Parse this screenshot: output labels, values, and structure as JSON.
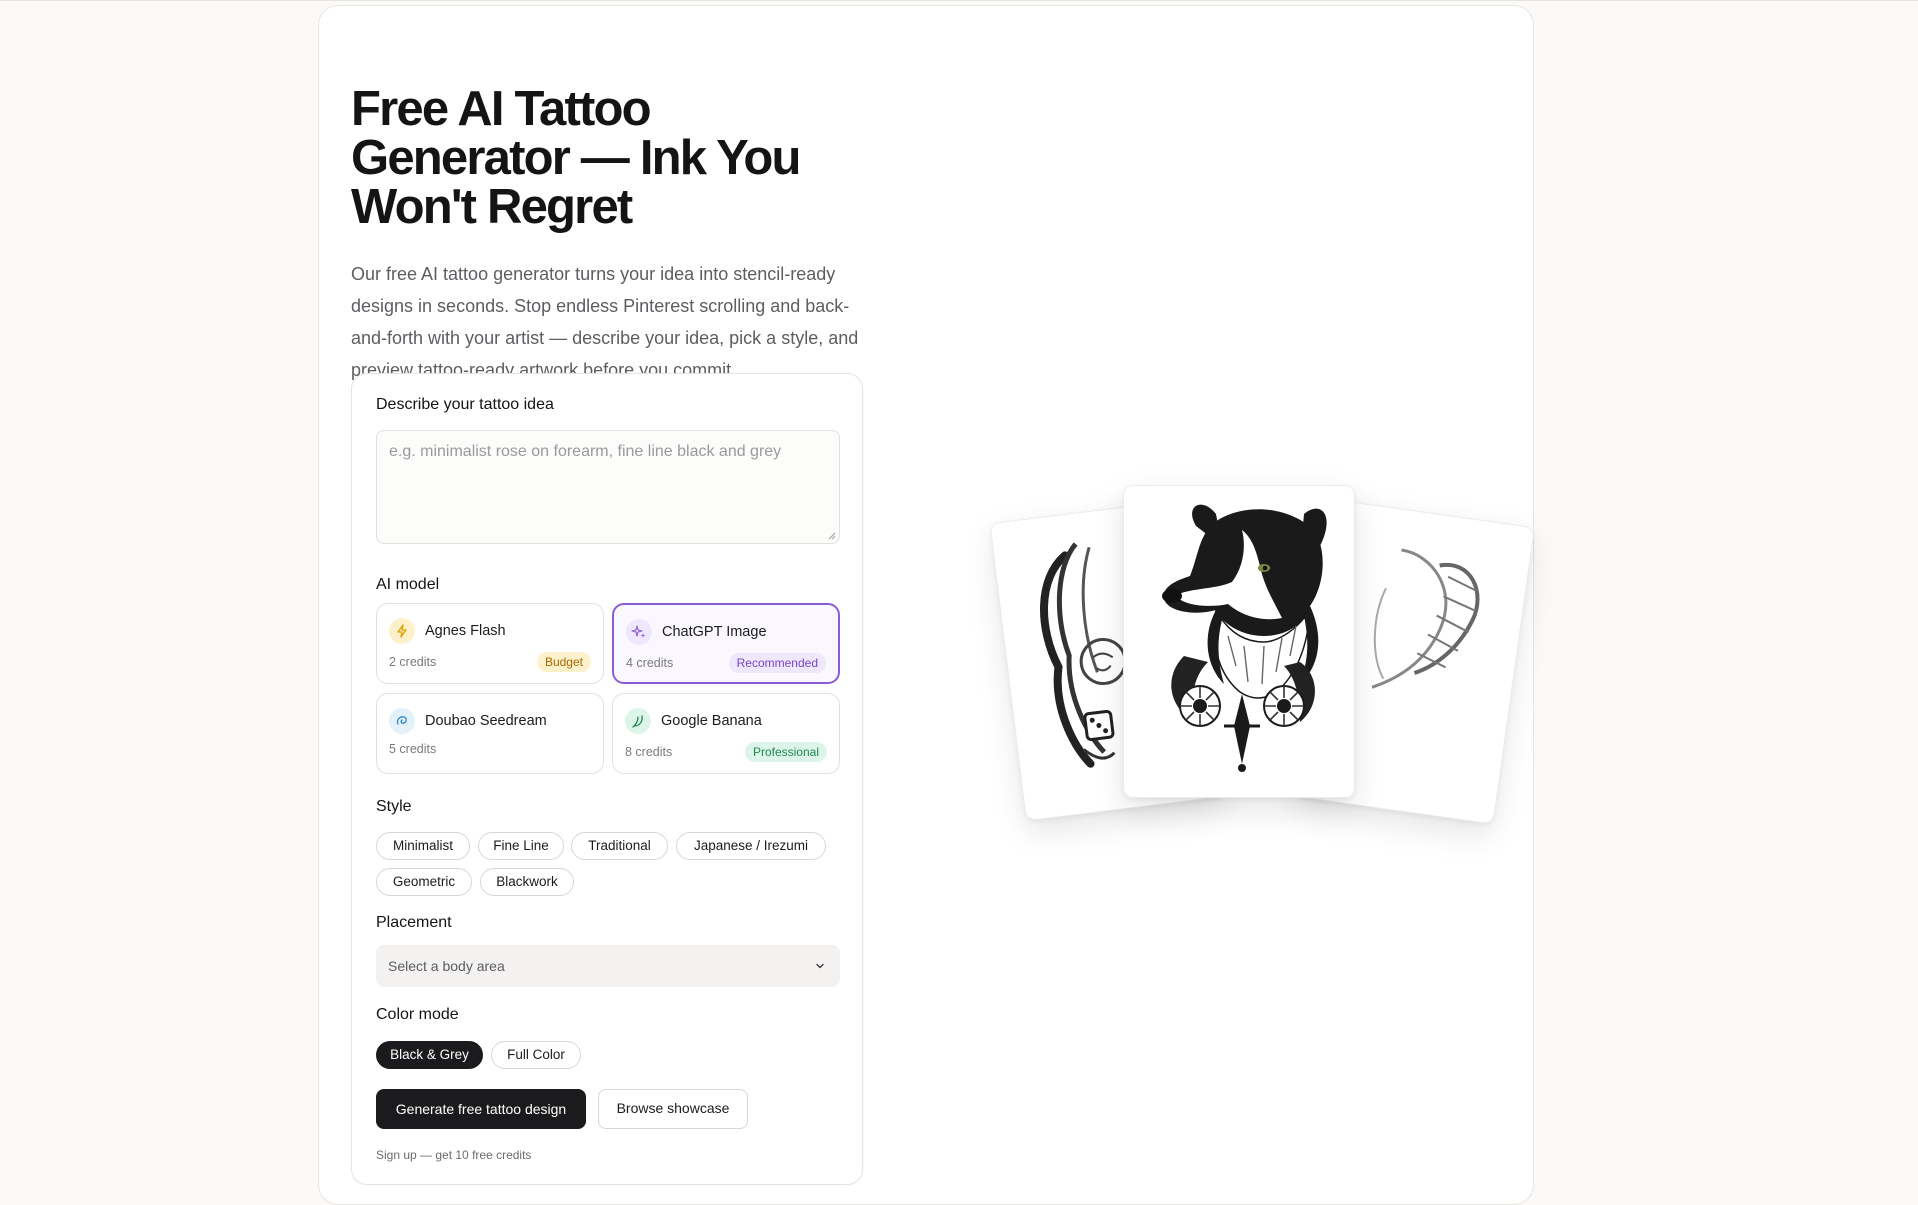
{
  "hero": {
    "title": "Free AI Tattoo Generator — Ink You Won't Regret",
    "subtitle": "Our free AI tattoo generator turns your idea into stencil-ready designs in seconds. Stop endless Pinterest scrolling and back-and-forth with your artist — describe your idea, pick a style, and preview tattoo-ready artwork before you commit."
  },
  "form": {
    "idea_label": "Describe your tattoo idea",
    "idea_placeholder": "e.g. minimalist rose on forearm, fine line black and grey",
    "idea_value": "",
    "model_label": "AI model",
    "models": [
      {
        "name": "Agnes Flash",
        "credits": "2 credits",
        "badge": "Budget",
        "icon": "lightning-icon",
        "selected": false
      },
      {
        "name": "ChatGPT Image",
        "credits": "4 credits",
        "badge": "Recommended",
        "icon": "sparkle-icon",
        "selected": true
      },
      {
        "name": "Doubao Seedream",
        "credits": "5 credits",
        "badge": "",
        "icon": "swirl-icon",
        "selected": false
      },
      {
        "name": "Google Banana",
        "credits": "8 credits",
        "badge": "Professional",
        "icon": "banana-icon",
        "selected": false
      }
    ],
    "style_label": "Style",
    "styles": [
      "Minimalist",
      "Fine Line",
      "Traditional",
      "Japanese / Irezumi",
      "Geometric",
      "Blackwork"
    ],
    "placement_label": "Placement",
    "placement_placeholder": "Select a body area",
    "color_label": "Color mode",
    "color_modes": [
      {
        "label": "Black & Grey",
        "selected": true
      },
      {
        "label": "Full Color",
        "selected": false
      }
    ],
    "generate_label": "Generate free tattoo design",
    "browse_label": "Browse showcase",
    "signup_note": "Sign up — get 10 free credits"
  },
  "colors": {
    "accent_purple": "#8a5cd6",
    "budget_bg": "#fdf1cc",
    "budget_text": "#a36a00",
    "recommended_bg": "#efe7fb",
    "recommended_text": "#7a44c9",
    "professional_bg": "#dcf5e8",
    "professional_text": "#1f8a55",
    "primary": "#1b1b1d"
  },
  "showcase": {
    "cards": [
      "woman-portrait-tattoo-image",
      "border-collie-tattoo-image",
      "winged-angel-tattoo-image"
    ]
  }
}
